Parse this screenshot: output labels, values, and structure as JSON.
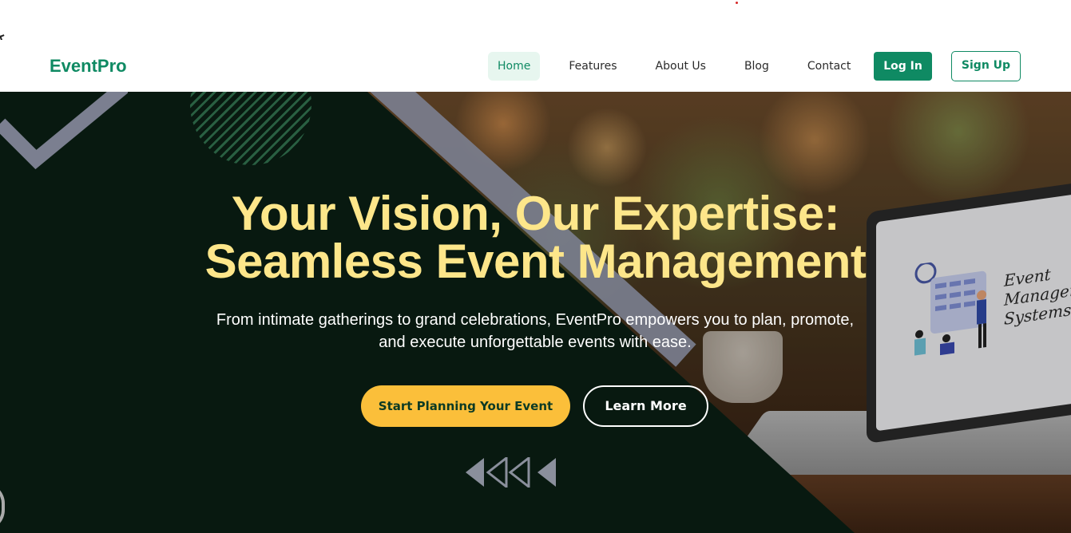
{
  "header": {
    "logo": "EventPro",
    "nav": [
      {
        "label": "Home",
        "active": true
      },
      {
        "label": "Features",
        "active": false
      },
      {
        "label": "About Us",
        "active": false
      },
      {
        "label": "Blog",
        "active": false
      },
      {
        "label": "Contact",
        "active": false
      }
    ],
    "login_label": "Log In",
    "signup_label": "Sign Up"
  },
  "hero": {
    "title_line1": "Your Vision, Our Expertise:",
    "title_line2": "Seamless Event Management",
    "subtitle": "From intimate gatherings to grand celebrations, EventPro empowers you to plan, promote, and execute unforgettable events with ease.",
    "primary_cta": "Start Planning Your Event",
    "secondary_cta": "Learn More",
    "laptop_screen_text": "Event\nManagement\nSystems"
  },
  "colors": {
    "brand_green": "#0f8a63",
    "title_yellow": "#fde68a",
    "cta_yellow": "#fbbf3a",
    "dark_panel": "#0a1f14"
  },
  "icons": {
    "scroll_arrows": "double-chevron-left-icon"
  }
}
